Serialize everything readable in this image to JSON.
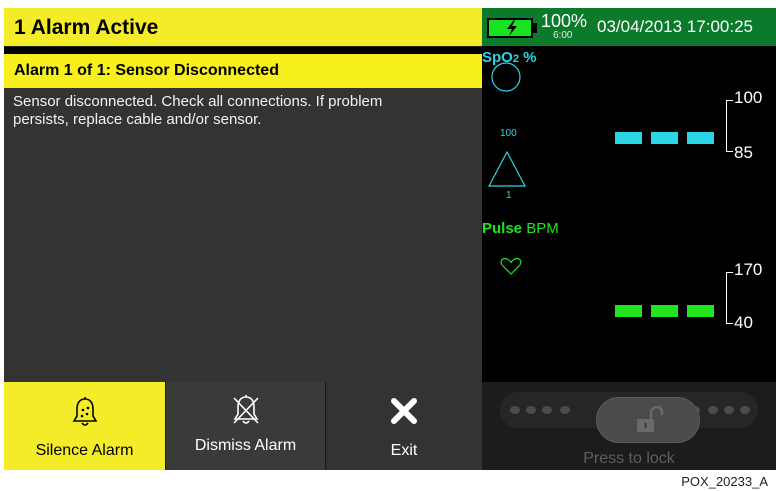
{
  "alarm": {
    "header": "1 Alarm Active",
    "title": "Alarm 1 of 1: Sensor Disconnected",
    "message": "Sensor disconnected. Check all connections. If problem persists, replace cable and/or sensor."
  },
  "status": {
    "battery_percent": "100%",
    "battery_time": "6:00",
    "datetime": "03/04/2013 17:00:25",
    "battery_color": "#19e31f",
    "bar_color": "#0b7a2a"
  },
  "spo2": {
    "label_main": "SpO",
    "label_sub": "2",
    "label_unit": " %",
    "circle_value": "100",
    "triangle_value": "1",
    "limit_high": "100",
    "limit_low": "85",
    "color": "#2ad6e6"
  },
  "pulse": {
    "label_main": "Pulse",
    "label_unit": " BPM",
    "limit_high": "170",
    "limit_low": "40",
    "color": "#1fe41f"
  },
  "buttons": {
    "silence": {
      "label": "Silence Alarm",
      "icon": "bell-icon"
    },
    "dismiss": {
      "label": "Dismiss Alarm",
      "icon": "crossed-bell-icon"
    },
    "exit": {
      "label": "Exit",
      "icon": "close-icon"
    }
  },
  "lock": {
    "label": "Press to lock",
    "icon": "unlocked-padlock-icon"
  },
  "footer": {
    "code": "POX_20233_A"
  }
}
